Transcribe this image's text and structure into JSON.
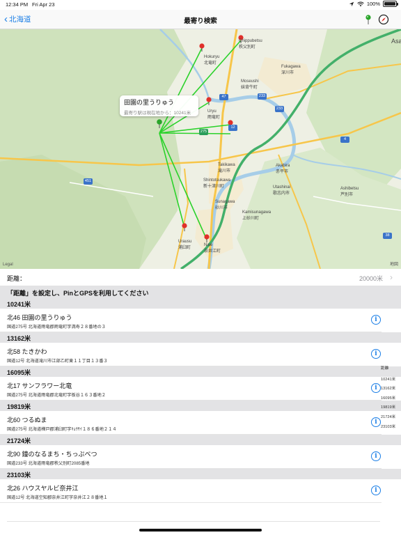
{
  "status": {
    "time": "12:34 PM",
    "date": "Fri Apr 23",
    "battery": "100%"
  },
  "nav": {
    "back_label": "北海道",
    "title": "最寄り検索",
    "pin_icon": "pin-icon",
    "compass_icon": "compass-icon"
  },
  "map": {
    "labels": [
      {
        "text": "Chippubetsu",
        "jp": "秩父別町"
      },
      {
        "text": "Hokuryu",
        "jp": "北竜町"
      },
      {
        "text": "Fukagawa",
        "jp": "深川市"
      },
      {
        "text": "Moseushi",
        "jp": "妹背牛町"
      },
      {
        "text": "Uryu",
        "jp": "雨竜町"
      },
      {
        "text": "Takikawa",
        "jp": "滝川市"
      },
      {
        "text": "Akabira",
        "jp": "赤平市"
      },
      {
        "text": "Shintotsukawa",
        "jp": "新十津川町"
      },
      {
        "text": "Utashinai",
        "jp": "歌志内市"
      },
      {
        "text": "Ashibetsu",
        "jp": "芦別市"
      },
      {
        "text": "Sunagawa",
        "jp": "砂川市"
      },
      {
        "text": "Kamisunagawa",
        "jp": "上砂川町"
      },
      {
        "text": "Urausu",
        "jp": "浦臼町"
      },
      {
        "text": "Naie",
        "jp": "奈井江町"
      },
      {
        "text": "Asa"
      }
    ],
    "shields": [
      "233",
      "47",
      "233",
      "275",
      "12",
      "4",
      "451",
      "38"
    ],
    "callout": {
      "title": "田園の里うりゅう",
      "subtitle": "最寄り駅は現在地から：10241米"
    },
    "corner_right": "地図",
    "corner_left": "Legal"
  },
  "distance": {
    "label": "距離：",
    "value": "20000米"
  },
  "hint": "「距離」を設定し、PinとGPSを利用してください",
  "sections": [
    {
      "header": "10241米",
      "name": "北46 田園の里うりゅう",
      "address": "国道275号 北海道雨竜郡雨竜町字満寿２８番地の３"
    },
    {
      "header": "13162米",
      "name": "北58 たきかわ",
      "address": "国道12号 北海道滝川市江部乙町東１１丁目１３番３"
    },
    {
      "header": "16095米",
      "name": "北17 サンフラワー北竜",
      "address": "国道275号 北海道雨竜郡北竜町字板谷１６３番地２"
    },
    {
      "header": "19819米",
      "name": "北60 つるぬま",
      "address": "国道275号 北海道樺戸郡浦臼町字ｷｮｳｻｲ１８６番地２１４"
    },
    {
      "header": "21724米",
      "name": "北90 鐘のなるまち・ちっぷべつ",
      "address": "国道233号 北海道雨竜郡秩父別町2085番地"
    },
    {
      "header": "23103米",
      "name": "北26 ハウスヤルビ奈井江",
      "address": "国道12号 北海道空知郡奈井江町字奈井江２８番地１"
    }
  ],
  "side_index": [
    "距離",
    "10241米",
    "13162米",
    "16095米",
    "19819米",
    "21724米",
    "23103米"
  ],
  "colors": {
    "accent": "#1a7ee6",
    "route_line": "#2bd22b",
    "pin_red": "#e0302a",
    "pin_green": "#2aa52a"
  }
}
